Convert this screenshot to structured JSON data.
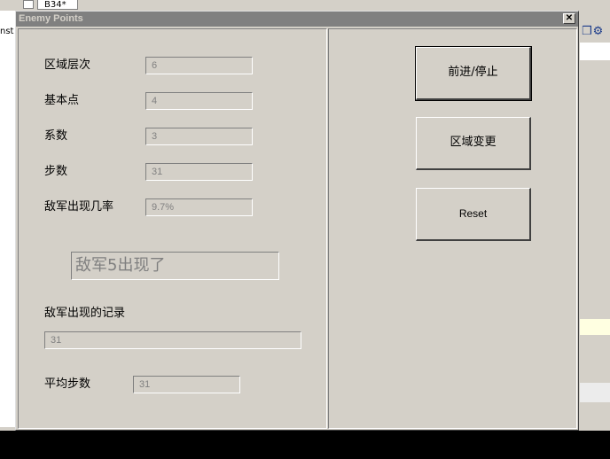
{
  "background": {
    "tab_label": "B34*",
    "left_text": "nst",
    "right_icons": "❒⚙"
  },
  "window": {
    "title": "Enemy Points",
    "close_glyph": "✕"
  },
  "form": {
    "zone_level": {
      "label": "区域层次",
      "value": "6"
    },
    "base_point": {
      "label": "基本点",
      "value": "4"
    },
    "coefficient": {
      "label": "系数",
      "value": "3"
    },
    "steps": {
      "label": "步数",
      "value": "31"
    },
    "enemy_rate": {
      "label": "敌军出现几率",
      "value": "9.7%"
    },
    "enemy_message": "敌军5出现了",
    "record": {
      "label": "敌军出现的记录",
      "value": "31"
    },
    "avg_steps": {
      "label": "平均步数",
      "value": "31"
    }
  },
  "buttons": {
    "advance_stop": "前进/停止",
    "zone_change": "区域变更",
    "reset": "Reset"
  },
  "colors": {
    "face": "#d4d0c8",
    "titlebar_inactive": "#808080",
    "disabled_text": "#808080"
  }
}
